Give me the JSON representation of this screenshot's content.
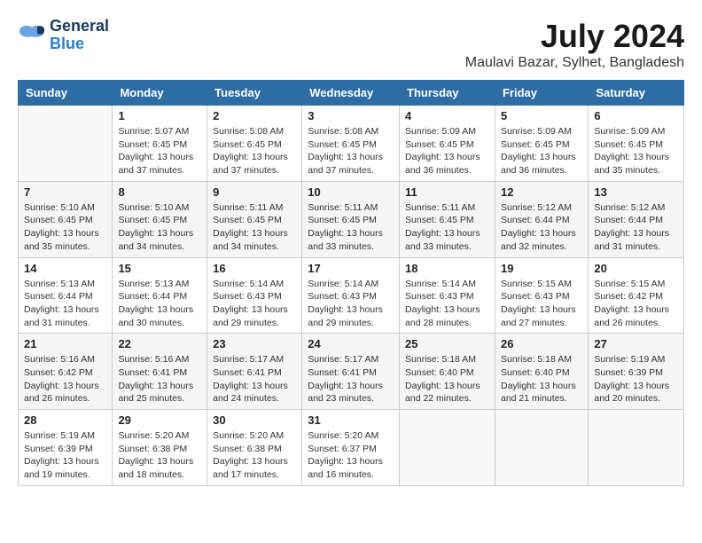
{
  "header": {
    "logo_line1": "General",
    "logo_line2": "Blue",
    "month_year": "July 2024",
    "location": "Maulavi Bazar, Sylhet, Bangladesh"
  },
  "days_of_week": [
    "Sunday",
    "Monday",
    "Tuesday",
    "Wednesday",
    "Thursday",
    "Friday",
    "Saturday"
  ],
  "weeks": [
    [
      {
        "day": "",
        "info": ""
      },
      {
        "day": "1",
        "info": "Sunrise: 5:07 AM\nSunset: 6:45 PM\nDaylight: 13 hours\nand 37 minutes."
      },
      {
        "day": "2",
        "info": "Sunrise: 5:08 AM\nSunset: 6:45 PM\nDaylight: 13 hours\nand 37 minutes."
      },
      {
        "day": "3",
        "info": "Sunrise: 5:08 AM\nSunset: 6:45 PM\nDaylight: 13 hours\nand 37 minutes."
      },
      {
        "day": "4",
        "info": "Sunrise: 5:09 AM\nSunset: 6:45 PM\nDaylight: 13 hours\nand 36 minutes."
      },
      {
        "day": "5",
        "info": "Sunrise: 5:09 AM\nSunset: 6:45 PM\nDaylight: 13 hours\nand 36 minutes."
      },
      {
        "day": "6",
        "info": "Sunrise: 5:09 AM\nSunset: 6:45 PM\nDaylight: 13 hours\nand 35 minutes."
      }
    ],
    [
      {
        "day": "7",
        "info": "Sunrise: 5:10 AM\nSunset: 6:45 PM\nDaylight: 13 hours\nand 35 minutes."
      },
      {
        "day": "8",
        "info": "Sunrise: 5:10 AM\nSunset: 6:45 PM\nDaylight: 13 hours\nand 34 minutes."
      },
      {
        "day": "9",
        "info": "Sunrise: 5:11 AM\nSunset: 6:45 PM\nDaylight: 13 hours\nand 34 minutes."
      },
      {
        "day": "10",
        "info": "Sunrise: 5:11 AM\nSunset: 6:45 PM\nDaylight: 13 hours\nand 33 minutes."
      },
      {
        "day": "11",
        "info": "Sunrise: 5:11 AM\nSunset: 6:45 PM\nDaylight: 13 hours\nand 33 minutes."
      },
      {
        "day": "12",
        "info": "Sunrise: 5:12 AM\nSunset: 6:44 PM\nDaylight: 13 hours\nand 32 minutes."
      },
      {
        "day": "13",
        "info": "Sunrise: 5:12 AM\nSunset: 6:44 PM\nDaylight: 13 hours\nand 31 minutes."
      }
    ],
    [
      {
        "day": "14",
        "info": "Sunrise: 5:13 AM\nSunset: 6:44 PM\nDaylight: 13 hours\nand 31 minutes."
      },
      {
        "day": "15",
        "info": "Sunrise: 5:13 AM\nSunset: 6:44 PM\nDaylight: 13 hours\nand 30 minutes."
      },
      {
        "day": "16",
        "info": "Sunrise: 5:14 AM\nSunset: 6:43 PM\nDaylight: 13 hours\nand 29 minutes."
      },
      {
        "day": "17",
        "info": "Sunrise: 5:14 AM\nSunset: 6:43 PM\nDaylight: 13 hours\nand 29 minutes."
      },
      {
        "day": "18",
        "info": "Sunrise: 5:14 AM\nSunset: 6:43 PM\nDaylight: 13 hours\nand 28 minutes."
      },
      {
        "day": "19",
        "info": "Sunrise: 5:15 AM\nSunset: 6:43 PM\nDaylight: 13 hours\nand 27 minutes."
      },
      {
        "day": "20",
        "info": "Sunrise: 5:15 AM\nSunset: 6:42 PM\nDaylight: 13 hours\nand 26 minutes."
      }
    ],
    [
      {
        "day": "21",
        "info": "Sunrise: 5:16 AM\nSunset: 6:42 PM\nDaylight: 13 hours\nand 26 minutes."
      },
      {
        "day": "22",
        "info": "Sunrise: 5:16 AM\nSunset: 6:41 PM\nDaylight: 13 hours\nand 25 minutes."
      },
      {
        "day": "23",
        "info": "Sunrise: 5:17 AM\nSunset: 6:41 PM\nDaylight: 13 hours\nand 24 minutes."
      },
      {
        "day": "24",
        "info": "Sunrise: 5:17 AM\nSunset: 6:41 PM\nDaylight: 13 hours\nand 23 minutes."
      },
      {
        "day": "25",
        "info": "Sunrise: 5:18 AM\nSunset: 6:40 PM\nDaylight: 13 hours\nand 22 minutes."
      },
      {
        "day": "26",
        "info": "Sunrise: 5:18 AM\nSunset: 6:40 PM\nDaylight: 13 hours\nand 21 minutes."
      },
      {
        "day": "27",
        "info": "Sunrise: 5:19 AM\nSunset: 6:39 PM\nDaylight: 13 hours\nand 20 minutes."
      }
    ],
    [
      {
        "day": "28",
        "info": "Sunrise: 5:19 AM\nSunset: 6:39 PM\nDaylight: 13 hours\nand 19 minutes."
      },
      {
        "day": "29",
        "info": "Sunrise: 5:20 AM\nSunset: 6:38 PM\nDaylight: 13 hours\nand 18 minutes."
      },
      {
        "day": "30",
        "info": "Sunrise: 5:20 AM\nSunset: 6:38 PM\nDaylight: 13 hours\nand 17 minutes."
      },
      {
        "day": "31",
        "info": "Sunrise: 5:20 AM\nSunset: 6:37 PM\nDaylight: 13 hours\nand 16 minutes."
      },
      {
        "day": "",
        "info": ""
      },
      {
        "day": "",
        "info": ""
      },
      {
        "day": "",
        "info": ""
      }
    ]
  ]
}
